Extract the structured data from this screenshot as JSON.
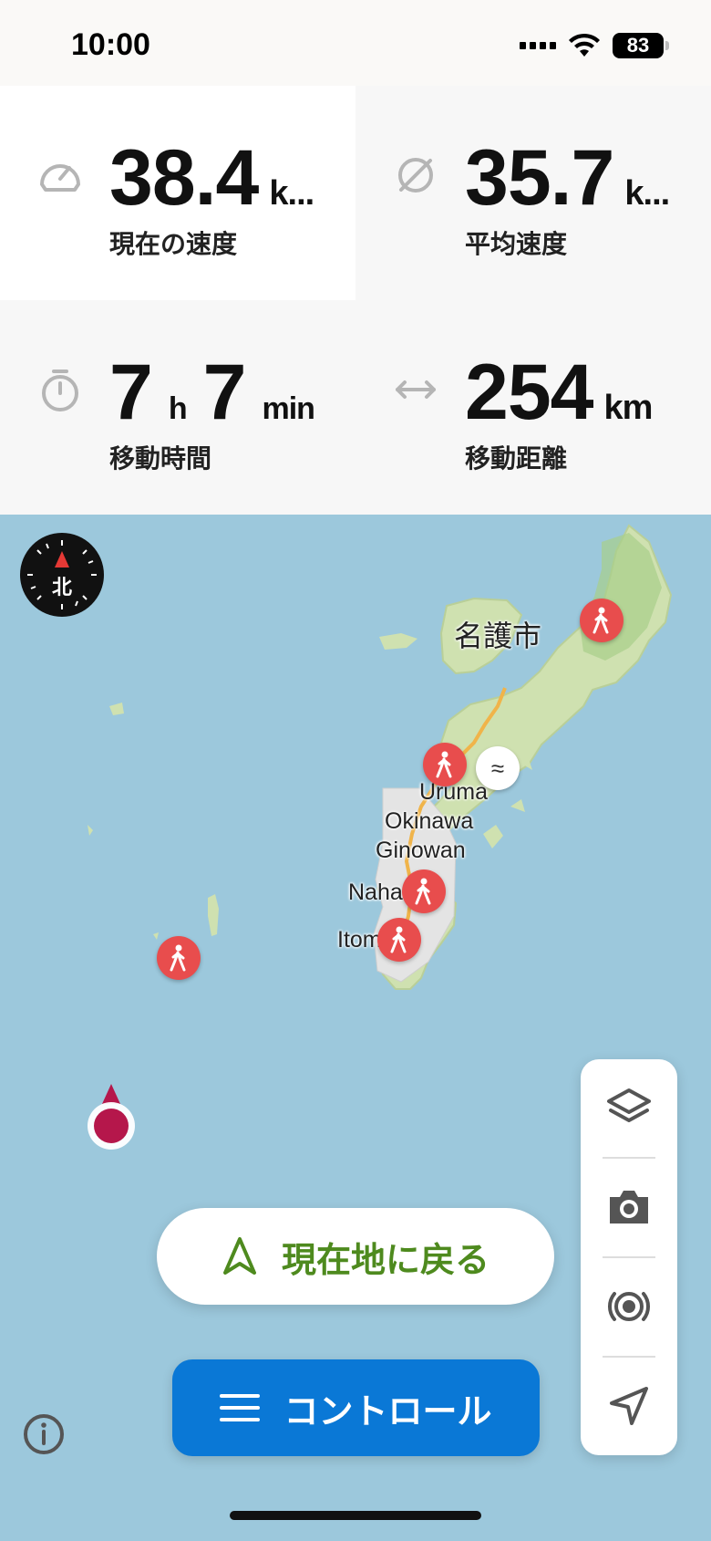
{
  "status_bar": {
    "time": "10:00",
    "battery": "83"
  },
  "stats": {
    "current_speed": {
      "value": "38.4",
      "unit": "k...",
      "label": "現在の速度"
    },
    "average_speed": {
      "value": "35.7",
      "unit": "k...",
      "label": "平均速度"
    },
    "moving_time": {
      "hours": "7",
      "hours_unit": "h",
      "minutes": "7",
      "minutes_unit": "min",
      "label": "移動時間"
    },
    "distance": {
      "value": "254",
      "unit": "km",
      "label": "移動距離"
    }
  },
  "map": {
    "compass_label": "北",
    "cities": {
      "nago": "名護市",
      "uruma": "Uruma",
      "okinawa": "Okinawa",
      "ginowan": "Ginowan",
      "naha": "Naha",
      "itoman": "Itoman"
    },
    "colors": {
      "sea": "#9cc8dc",
      "land": "#cfe1b0",
      "urban": "#e4e4e4",
      "poi": "#e84d4d"
    }
  },
  "buttons": {
    "recenter_label": "現在地に戻る",
    "control_label": "コントロール"
  },
  "icons": {
    "speed": "speedometer-icon",
    "average": "diameter-icon",
    "time": "stopwatch-icon",
    "distance": "horizontal-arrows-icon",
    "layers": "layers-icon",
    "camera": "camera-icon",
    "broadcast": "broadcast-icon",
    "navigate": "navigation-arrow-icon",
    "info": "info-icon"
  }
}
